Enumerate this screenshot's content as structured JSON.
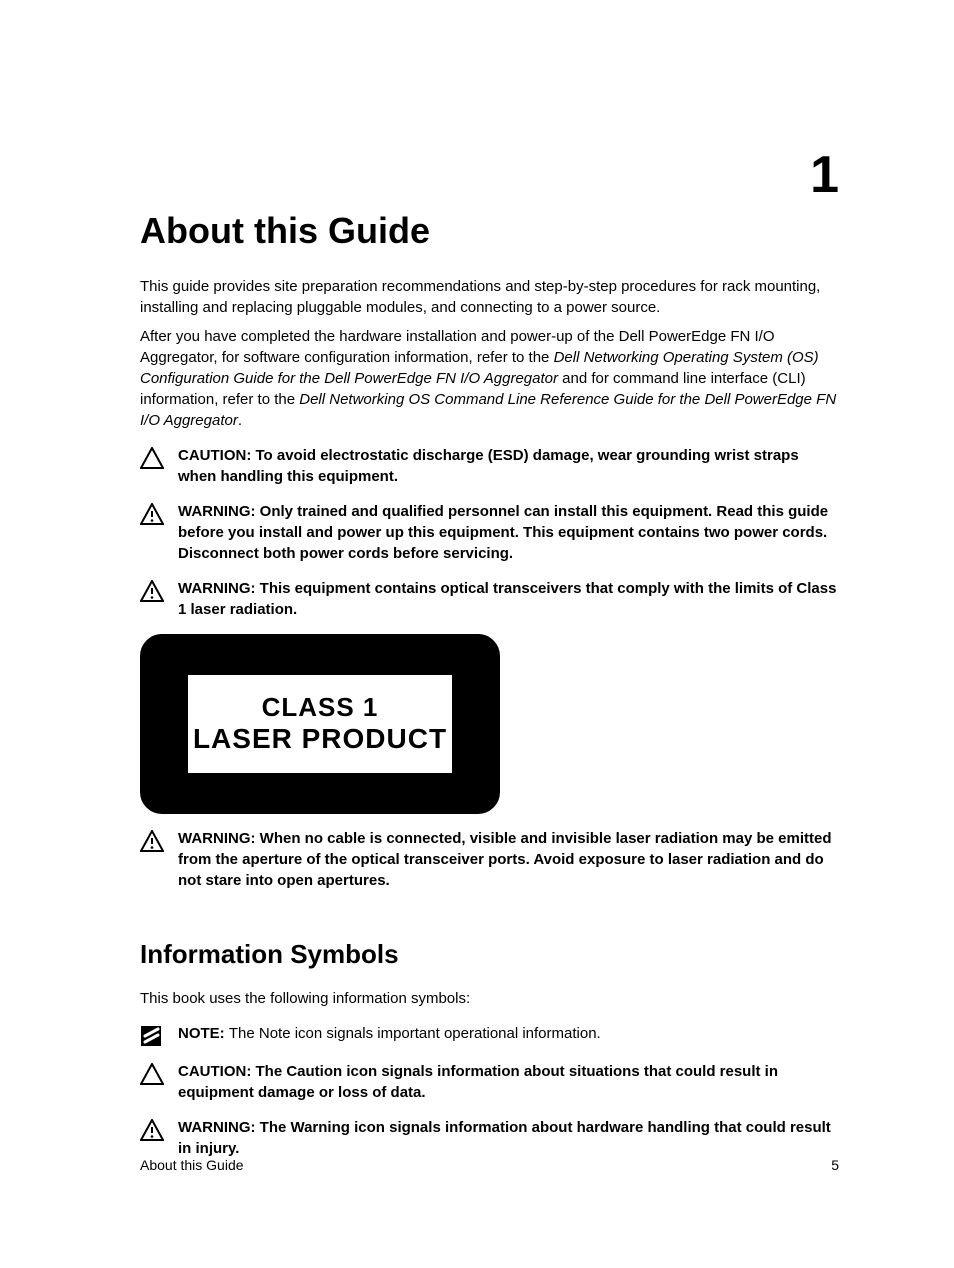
{
  "chapter": "1",
  "title": "About this Guide",
  "intro_para_1": "This guide provides site preparation recommendations and step-by-step procedures for rack mounting, installing and replacing pluggable modules, and connecting to a power source.",
  "intro_para_2a": "After you have completed the hardware installation and power-up of the Dell PowerEdge FN I/O Aggregator, for software configuration information, refer to the ",
  "intro_para_2b_italic": "Dell Networking Operating System (OS) Configuration Guide for the Dell PowerEdge FN I/O Aggregator",
  "intro_para_2c": " and for command line interface (CLI) information, refer to the ",
  "intro_para_2d_italic": "Dell Networking OS Command Line Reference Guide for the Dell PowerEdge FN I/O Aggregator",
  "intro_para_2e": ".",
  "caution_1": "CAUTION: To avoid electrostatic discharge (ESD) damage, wear grounding wrist straps when handling this equipment.",
  "warning_1": "WARNING: Only trained and qualified personnel can install this equipment. Read this guide before you install and power up this equipment. This equipment contains two power cords. Disconnect both power cords before servicing.",
  "warning_2": "WARNING: This equipment contains optical transceivers that comply with the limits of Class 1 laser radiation.",
  "laser_label_line1": "CLASS 1",
  "laser_label_line2": "LASER PRODUCT",
  "warning_3": "WARNING: When no cable is connected, visible and invisible laser radiation may be emitted from the aperture of the optical transceiver ports. Avoid exposure to laser radiation and do not stare into open apertures.",
  "section_title": "Information Symbols",
  "section_intro": "This book uses the following information symbols:",
  "note_prefix": "NOTE: ",
  "note_body": "The Note icon signals important operational information.",
  "caution_2": "CAUTION: The Caution icon signals information about situations that could result in equipment damage or loss of data.",
  "warning_4": "WARNING: The Warning icon signals information about hardware handling that could result in injury.",
  "footer_left": "About this Guide",
  "footer_right": "5"
}
